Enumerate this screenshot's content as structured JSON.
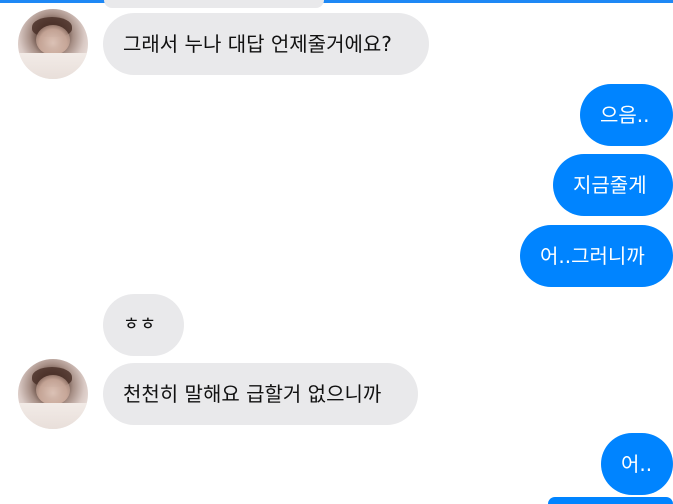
{
  "messages": [
    {
      "side": "in",
      "text": "그래서 누나 대답 언제줄거에요?",
      "avatar": true
    },
    {
      "side": "out",
      "text": "으음.."
    },
    {
      "side": "out",
      "text": "지금줄게"
    },
    {
      "side": "out",
      "text": "어..그러니까"
    },
    {
      "side": "in",
      "text": "ㅎㅎ",
      "avatar": false
    },
    {
      "side": "in",
      "text": "천천히 말해요 급할거 없으니까",
      "avatar": true
    },
    {
      "side": "out",
      "text": "어.."
    }
  ],
  "colors": {
    "incoming_bubble": "#e9e9eb",
    "outgoing_bubble": "#0084ff",
    "top_accent": "#1e88f5"
  }
}
